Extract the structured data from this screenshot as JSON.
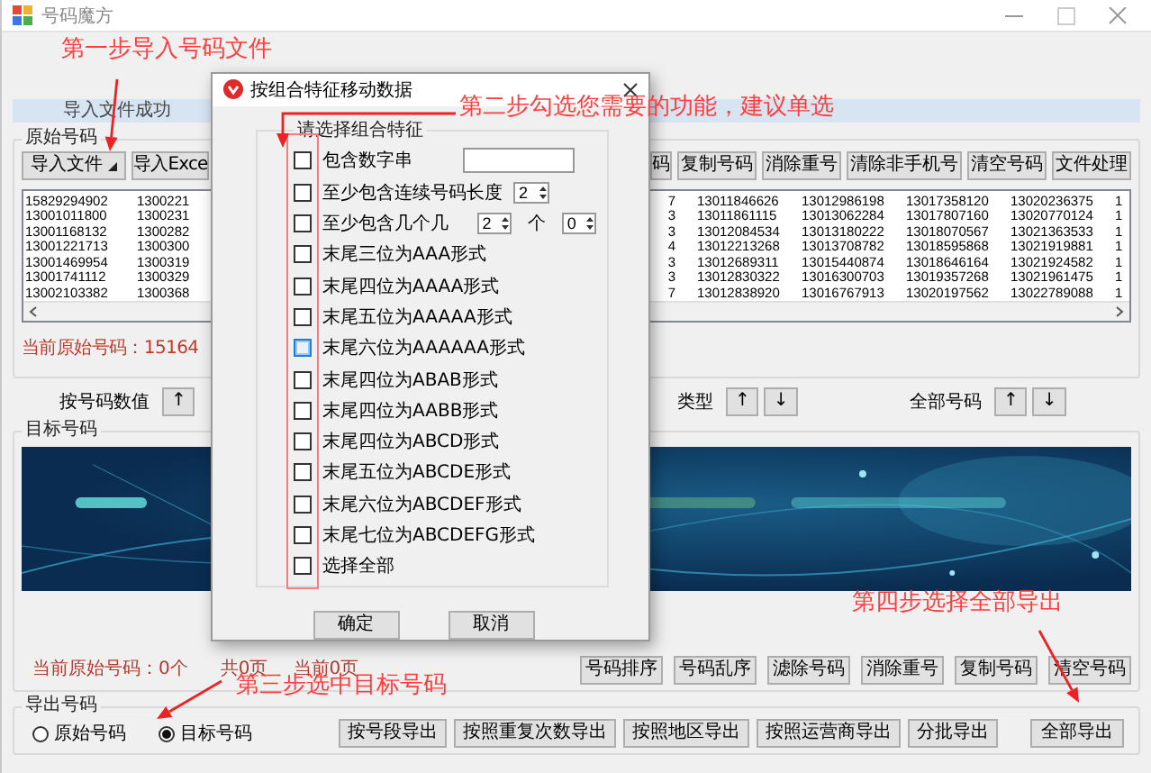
{
  "window": {
    "title": "号码魔方"
  },
  "status": "导入文件成功",
  "source_group": {
    "title": "原始号码",
    "buttons": [
      {
        "label": "导入文件",
        "kind": "menu"
      },
      {
        "label": "导入Exce",
        "kind": "plain"
      },
      {
        "label": "码",
        "kind": "plain"
      },
      {
        "label": "复制号码",
        "kind": "plain"
      },
      {
        "label": "消除重号",
        "kind": "plain"
      },
      {
        "label": "清除非手机号",
        "kind": "plain"
      },
      {
        "label": "清空号码",
        "kind": "plain"
      },
      {
        "label": "文件处理",
        "kind": "plain"
      }
    ],
    "table": {
      "rows": [
        [
          "15829294902",
          "1300221",
          "7",
          "13011846626",
          "13012986198",
          "13017358120",
          "13020236375",
          "1"
        ],
        [
          "13001011800",
          "1300231",
          "3",
          "13011861115",
          "13013062284",
          "13017807160",
          "13020770124",
          "1"
        ],
        [
          "13001168132",
          "1300282",
          "3",
          "13012084534",
          "13013180222",
          "13018070567",
          "13021363533",
          "1"
        ],
        [
          "13001221713",
          "1300300",
          "4",
          "13012213268",
          "13013708782",
          "13018595868",
          "13021919881",
          "1"
        ],
        [
          "13001469954",
          "1300319",
          "3",
          "13012689311",
          "13015440874",
          "13018646164",
          "13021924582",
          "1"
        ],
        [
          "13001741112",
          "1300329",
          "3",
          "13012830322",
          "13016300703",
          "13019357268",
          "13021961475",
          "1"
        ],
        [
          "13002103382",
          "1300368",
          "7",
          "13012838920",
          "13016767913",
          "13020197562",
          "13022789088",
          "1"
        ]
      ]
    },
    "count": "当前原始号码：15164"
  },
  "sort_row": [
    {
      "label": "按号码数值",
      "buttons": [
        "↑"
      ]
    },
    {
      "label": "类型",
      "buttons": [
        "↑",
        "↓"
      ]
    },
    {
      "label": "全部号码",
      "buttons": [
        "↑",
        "↓"
      ]
    }
  ],
  "target_group": {
    "title": "目标号码",
    "banner": {
      "kind": "picture"
    },
    "page_info": [
      "当前原始号码：0个",
      "共0页",
      "当前0页"
    ],
    "buttons": [
      "号码排序",
      "号码乱序",
      "滤除号码",
      "消除重号",
      "复制号码",
      "清空号码"
    ]
  },
  "export_group": {
    "title": "导出号码",
    "radios": [
      {
        "label": "原始号码",
        "selected": false
      },
      {
        "label": "目标号码",
        "selected": true
      }
    ],
    "buttons": [
      "按号段导出",
      "按照重复次数导出",
      "按照地区导出",
      "按照运营商导出",
      "分批导出"
    ],
    "final_button": "全部导出"
  },
  "dialog": {
    "title": "按组合特征移动数据",
    "group": "请选择组合特征",
    "options": [
      {
        "kind": "field",
        "label": "包含数字串",
        "checked": false,
        "focused": false
      },
      {
        "kind": "spinner",
        "label": "至少包含连续号码长度",
        "checked": false,
        "focused": false,
        "value": "2"
      },
      {
        "kind": "two_spinners",
        "label": "至少包含几个几",
        "checked": false,
        "focused": false,
        "value": "2",
        "unit": "个",
        "value2": "0"
      },
      {
        "kind": "plain",
        "label": "末尾三位为AAA形式",
        "checked": false,
        "focused": false
      },
      {
        "kind": "plain",
        "label": "末尾四位为AAAA形式",
        "checked": false,
        "focused": false
      },
      {
        "kind": "plain",
        "label": "末尾五位为AAAAA形式",
        "checked": false,
        "focused": false
      },
      {
        "kind": "plain",
        "label": "末尾六位为AAAAAA形式",
        "checked": false,
        "focused": true
      },
      {
        "kind": "plain",
        "label": "末尾四位为ABAB形式",
        "checked": false,
        "focused": false
      },
      {
        "kind": "plain",
        "label": "末尾四位为AABB形式",
        "checked": false,
        "focused": false
      },
      {
        "kind": "plain",
        "label": "末尾四位为ABCD形式",
        "checked": false,
        "focused": false
      },
      {
        "kind": "plain",
        "label": "末尾五位为ABCDE形式",
        "checked": false,
        "focused": false
      },
      {
        "kind": "plain",
        "label": "末尾六位为ABCDEF形式",
        "checked": false,
        "focused": false
      },
      {
        "kind": "plain",
        "label": "末尾七位为ABCDEFG形式",
        "checked": false,
        "focused": false
      },
      {
        "kind": "plain",
        "label": "选择全部",
        "checked": false,
        "focused": false
      }
    ],
    "buttons": [
      "确定",
      "取消"
    ]
  },
  "annotations": [
    {
      "text": "第一步导入号码文件"
    },
    {
      "text": "第二步勾选您需要的功能，建议单选"
    },
    {
      "text": "第三步选中目标号码"
    },
    {
      "text": "第四步选择全部导出"
    }
  ]
}
